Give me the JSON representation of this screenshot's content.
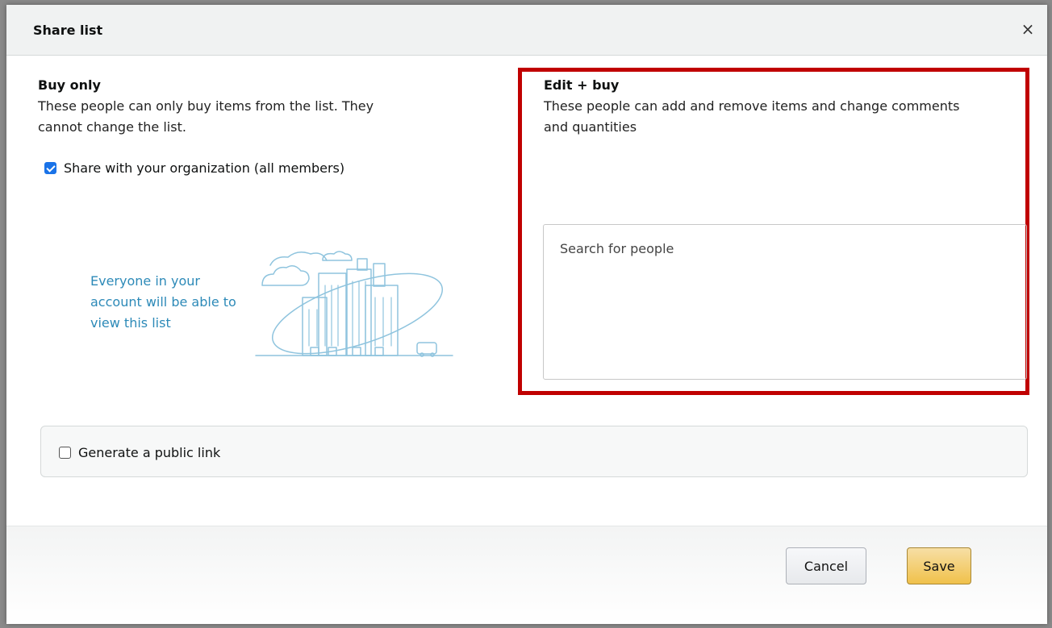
{
  "dialog": {
    "title": "Share list",
    "close_symbol": "×"
  },
  "buy_only": {
    "title": "Buy only",
    "description": "These people can only buy items from the list. They cannot change the list.",
    "share_checkbox_label": "Share with your organization (all members)",
    "share_checked": true,
    "org_message": "Everyone in your account will be able to view this list",
    "illustration_icon": "city-buildings-icon"
  },
  "edit_buy": {
    "title": "Edit + buy",
    "description": "These people can add and remove items and change comments and quantities",
    "search_placeholder": "Search for people",
    "highlight_color": "#c00000"
  },
  "public_link": {
    "label": "Generate a public link",
    "checked": false
  },
  "footer": {
    "cancel_label": "Cancel",
    "save_label": "Save"
  },
  "colors": {
    "accent_blue": "#1a73e8",
    "message_blue": "#2d8ab8",
    "save_yellow": "#f0c14b"
  }
}
